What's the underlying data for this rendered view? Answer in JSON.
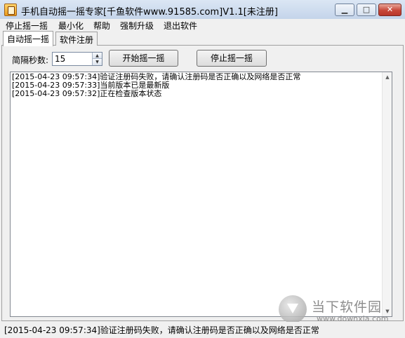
{
  "window": {
    "title": "手机自动摇一摇专家[千鱼软件www.91585.com]V1.1[未注册]",
    "min_label": "▁",
    "max_label": "□",
    "close_label": "✕"
  },
  "menu": {
    "items": [
      "停止摇一摇",
      "最小化",
      "帮助",
      "强制升级",
      "退出软件"
    ]
  },
  "tabs": [
    "自动摇一摇",
    "软件注册"
  ],
  "controls": {
    "interval_label": "简隔秒数:",
    "interval_value": "15",
    "start_button": "开始摇一摇",
    "stop_button": "停止摇一摇"
  },
  "log": {
    "lines": [
      "[2015-04-23 09:57:34]验证注册码失败，请确认注册码是否正确以及网络是否正常",
      "[2015-04-23 09:57:33]当前版本已是最新版",
      "[2015-04-23 09:57:32]正在检查版本状态"
    ]
  },
  "watermark": {
    "name": "当下软件园",
    "url": "www.downxia.com"
  },
  "status": {
    "text": "[2015-04-23 09:57:34]验证注册码失败，请确认注册码是否正确以及网络是否正常"
  }
}
